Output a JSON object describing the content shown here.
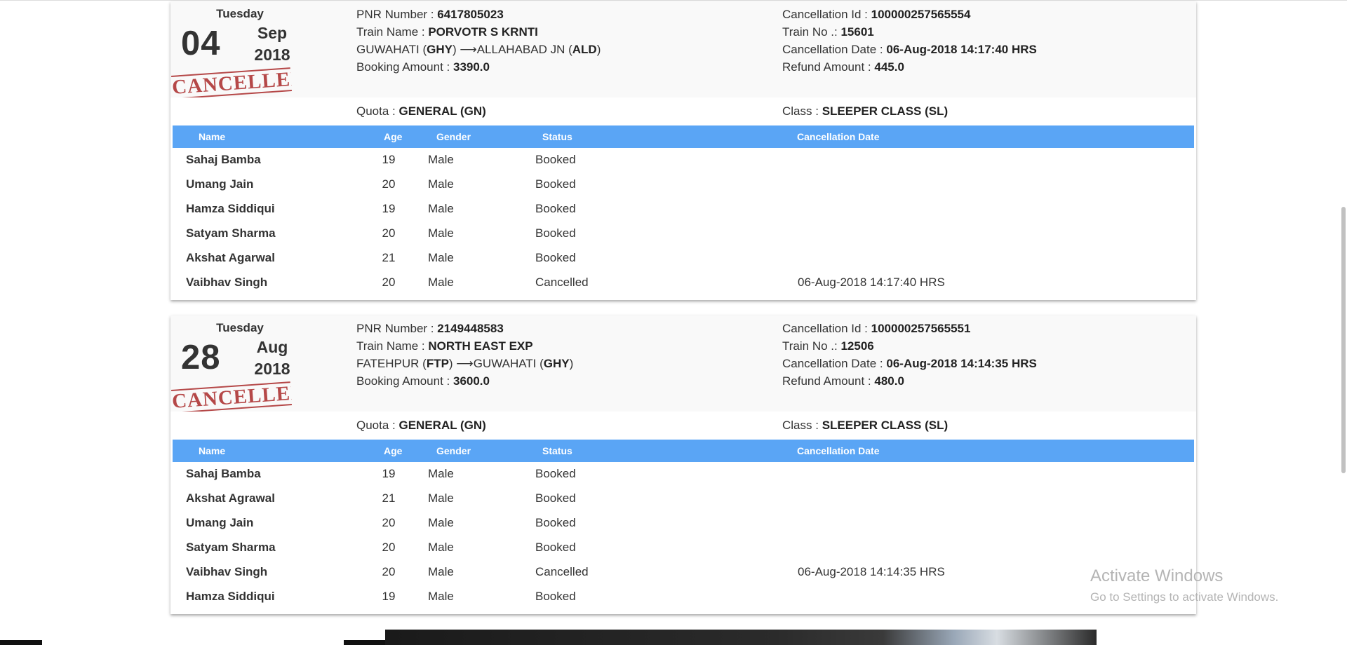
{
  "bookings": [
    {
      "day_of_week": "Tuesday",
      "day": "04",
      "month": "Sep",
      "year": "2018",
      "stamp": "CANCELLED",
      "pnr_label": "PNR Number : ",
      "pnr": "6417805023",
      "train_name_label": "Train Name : ",
      "train_name": "PORVOTR S KRNTI",
      "from_station": "GUWAHATI (",
      "from_code": "GHY",
      "arrow": ") ⟶",
      "to_station": "ALLAHABAD JN (",
      "to_code": "ALD",
      "route_end": ")",
      "booking_amount_label": "Booking Amount : ",
      "booking_amount": "3390.0",
      "cancellation_id_label": "Cancellation Id : ",
      "cancellation_id": "100000257565554",
      "train_no_label": "Train No .: ",
      "train_no": "15601",
      "cancellation_date_label": "Cancellation Date : ",
      "cancellation_date": "06-Aug-2018 14:17:40 HRS",
      "refund_amount_label": "Refund Amount : ",
      "refund_amount": "445.0",
      "quota_label": "Quota : ",
      "quota": "GENERAL (GN)",
      "class_label": "Class : ",
      "class": "SLEEPER CLASS (SL)",
      "passengers": [
        {
          "name": "Sahaj Bamba",
          "age": "19",
          "gender": "Male",
          "status": "Booked",
          "cancellation_date": ""
        },
        {
          "name": "Umang Jain",
          "age": "20",
          "gender": "Male",
          "status": "Booked",
          "cancellation_date": ""
        },
        {
          "name": "Hamza Siddiqui",
          "age": "19",
          "gender": "Male",
          "status": "Booked",
          "cancellation_date": ""
        },
        {
          "name": "Satyam Sharma",
          "age": "20",
          "gender": "Male",
          "status": "Booked",
          "cancellation_date": ""
        },
        {
          "name": "Akshat Agarwal",
          "age": "21",
          "gender": "Male",
          "status": "Booked",
          "cancellation_date": ""
        },
        {
          "name": "Vaibhav Singh",
          "age": "20",
          "gender": "Male",
          "status": "Cancelled",
          "cancellation_date": "06-Aug-2018 14:17:40 HRS"
        }
      ]
    },
    {
      "day_of_week": "Tuesday",
      "day": "28",
      "month": "Aug",
      "year": "2018",
      "stamp": "CANCELLED",
      "pnr_label": "PNR Number : ",
      "pnr": "2149448583",
      "train_name_label": "Train Name : ",
      "train_name": "NORTH EAST EXP",
      "from_station": "FATEHPUR (",
      "from_code": "FTP",
      "arrow": ") ⟶",
      "to_station": "GUWAHATI (",
      "to_code": "GHY",
      "route_end": ")",
      "booking_amount_label": "Booking Amount : ",
      "booking_amount": "3600.0",
      "cancellation_id_label": "Cancellation Id : ",
      "cancellation_id": "100000257565551",
      "train_no_label": "Train No .: ",
      "train_no": "12506",
      "cancellation_date_label": "Cancellation Date : ",
      "cancellation_date": "06-Aug-2018 14:14:35 HRS",
      "refund_amount_label": "Refund Amount : ",
      "refund_amount": "480.0",
      "quota_label": "Quota : ",
      "quota": "GENERAL (GN)",
      "class_label": "Class : ",
      "class": "SLEEPER CLASS (SL)",
      "passengers": [
        {
          "name": "Sahaj Bamba",
          "age": "19",
          "gender": "Male",
          "status": "Booked",
          "cancellation_date": ""
        },
        {
          "name": "Akshat Agrawal",
          "age": "21",
          "gender": "Male",
          "status": "Booked",
          "cancellation_date": ""
        },
        {
          "name": "Umang Jain",
          "age": "20",
          "gender": "Male",
          "status": "Booked",
          "cancellation_date": ""
        },
        {
          "name": "Satyam Sharma",
          "age": "20",
          "gender": "Male",
          "status": "Booked",
          "cancellation_date": ""
        },
        {
          "name": "Vaibhav Singh",
          "age": "20",
          "gender": "Male",
          "status": "Cancelled",
          "cancellation_date": "06-Aug-2018 14:14:35 HRS"
        },
        {
          "name": "Hamza Siddiqui",
          "age": "19",
          "gender": "Male",
          "status": "Booked",
          "cancellation_date": ""
        }
      ]
    }
  ],
  "table_headers": {
    "name": "Name",
    "age": "Age",
    "gender": "Gender",
    "status": "Status",
    "cancellation_date": "Cancellation Date"
  },
  "watermark": {
    "title": "Activate Windows",
    "subtitle": "Go to Settings to activate Windows."
  },
  "colors": {
    "table_header_bg": "#5aa5f5",
    "stamp": "#b03a3a",
    "card_header_bg": "#f9f9f9"
  }
}
